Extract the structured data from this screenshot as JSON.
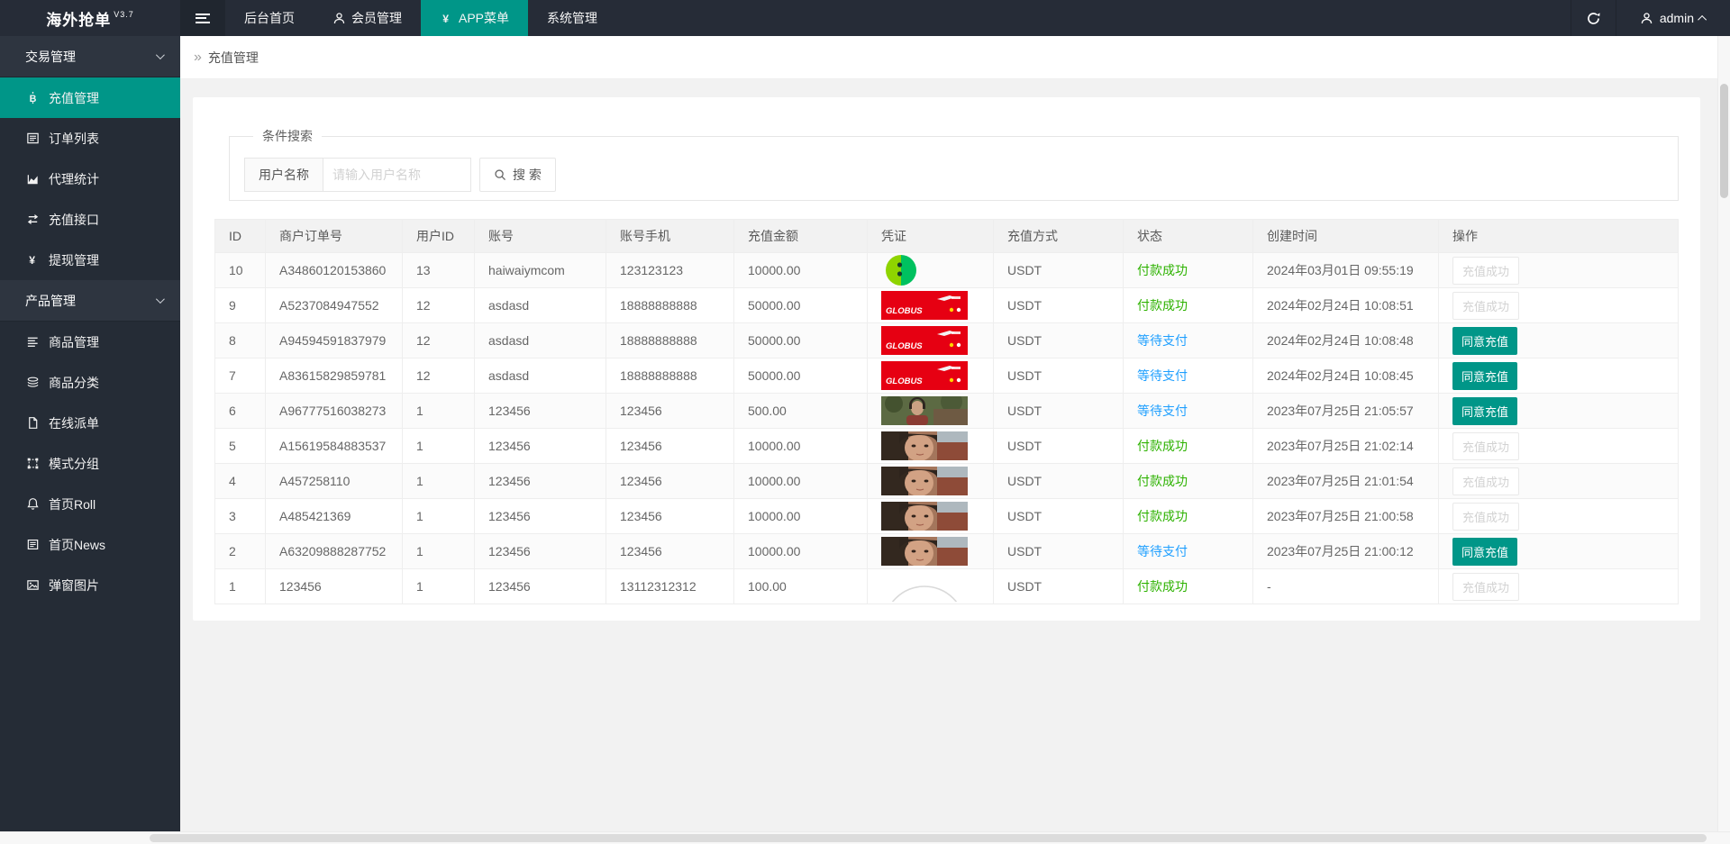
{
  "app": {
    "title": "海外抢单",
    "version": "V3.7",
    "admin": "admin"
  },
  "topnav": {
    "items": [
      {
        "key": "home",
        "label": "后台首页",
        "icon": null,
        "active": false
      },
      {
        "key": "members",
        "label": "会员管理",
        "icon": "person-icon",
        "active": false
      },
      {
        "key": "app-menu",
        "label": "APP菜单",
        "icon": "yen-icon",
        "active": true
      },
      {
        "key": "system",
        "label": "系统管理",
        "icon": null,
        "active": false
      }
    ]
  },
  "sidebar": {
    "items": [
      {
        "key": "trade-group",
        "type": "group",
        "label": "交易管理"
      },
      {
        "key": "recharge-manage",
        "type": "item",
        "label": "充值管理",
        "icon": "bitcoin-icon",
        "active": true
      },
      {
        "key": "order-list",
        "type": "item",
        "label": "订单列表",
        "icon": "order-frame-icon",
        "active": false
      },
      {
        "key": "agent-stats",
        "type": "item",
        "label": "代理统计",
        "icon": "area-chart-icon",
        "active": false
      },
      {
        "key": "recharge-api",
        "type": "item",
        "label": "充值接口",
        "icon": "swap-icon",
        "active": false
      },
      {
        "key": "withdraw-manage",
        "type": "item",
        "label": "提现管理",
        "icon": "yen-icon",
        "active": false
      },
      {
        "key": "product-group",
        "type": "group",
        "label": "产品管理"
      },
      {
        "key": "goods-manage",
        "type": "item",
        "label": "商品管理",
        "icon": "list-icon",
        "active": false
      },
      {
        "key": "goods-category",
        "type": "item",
        "label": "商品分类",
        "icon": "layers-icon",
        "active": false
      },
      {
        "key": "online-dispatch",
        "type": "item",
        "label": "在线派单",
        "icon": "file-icon",
        "active": false
      },
      {
        "key": "mode-group",
        "type": "item",
        "label": "模式分组",
        "icon": "object-group-icon",
        "active": false
      },
      {
        "key": "home-roll",
        "type": "item",
        "label": "首页Roll",
        "icon": "bell-icon",
        "active": false
      },
      {
        "key": "home-news",
        "type": "item",
        "label": "首页News",
        "icon": "news-icon",
        "active": false
      },
      {
        "key": "popup-image",
        "type": "item",
        "label": "弹窗图片",
        "icon": "image-icon",
        "active": false
      }
    ]
  },
  "breadcrumb": {
    "icon": "double-chevron-icon",
    "label": "充值管理",
    "icon_glyph": "»"
  },
  "search": {
    "legend": "条件搜索",
    "field_label": "用户名称",
    "placeholder": "请输入用户名称",
    "button": "搜 索"
  },
  "table": {
    "headers": [
      "ID",
      "商户订单号",
      "用户ID",
      "账号",
      "账号手机",
      "充值金额",
      "凭证",
      "充值方式",
      "状态",
      "创建时间",
      "操作"
    ],
    "rows": [
      {
        "id": "10",
        "order_no": "A34860120153860",
        "user_id": "13",
        "account": "haiwaiymcom",
        "phone": "123123123",
        "amount": "10000.00",
        "voucher": "green-logo-image",
        "method": "USDT",
        "status": "付款成功",
        "status_state": "success",
        "created": "2024年03月01日 09:55:19",
        "action": "充值成功",
        "action_state": "done"
      },
      {
        "id": "9",
        "order_no": "A5237084947552",
        "user_id": "12",
        "account": "asdasd",
        "phone": "18888888888",
        "amount": "50000.00",
        "voucher": "red-banner-image",
        "method": "USDT",
        "status": "付款成功",
        "status_state": "success",
        "created": "2024年02月24日 10:08:51",
        "action": "充值成功",
        "action_state": "done"
      },
      {
        "id": "8",
        "order_no": "A94594591837979",
        "user_id": "12",
        "account": "asdasd",
        "phone": "18888888888",
        "amount": "50000.00",
        "voucher": "red-banner-image",
        "method": "USDT",
        "status": "等待支付",
        "status_state": "waiting",
        "created": "2024年02月24日 10:08:48",
        "action": "同意充值",
        "action_state": "approve"
      },
      {
        "id": "7",
        "order_no": "A83615829859781",
        "user_id": "12",
        "account": "asdasd",
        "phone": "18888888888",
        "amount": "50000.00",
        "voucher": "red-banner-image",
        "method": "USDT",
        "status": "等待支付",
        "status_state": "waiting",
        "created": "2024年02月24日 10:08:45",
        "action": "同意充值",
        "action_state": "approve"
      },
      {
        "id": "6",
        "order_no": "A96777516038273",
        "user_id": "1",
        "account": "123456",
        "phone": "123456",
        "amount": "500.00",
        "voucher": "photo-outdoor-image",
        "method": "USDT",
        "status": "等待支付",
        "status_state": "waiting",
        "created": "2023年07月25日 21:05:57",
        "action": "同意充值",
        "action_state": "approve"
      },
      {
        "id": "5",
        "order_no": "A15619584883537",
        "user_id": "1",
        "account": "123456",
        "phone": "123456",
        "amount": "10000.00",
        "voucher": "photo-face-image",
        "method": "USDT",
        "status": "付款成功",
        "status_state": "success",
        "created": "2023年07月25日 21:02:14",
        "action": "充值成功",
        "action_state": "done"
      },
      {
        "id": "4",
        "order_no": "A457258110",
        "user_id": "1",
        "account": "123456",
        "phone": "123456",
        "amount": "10000.00",
        "voucher": "photo-face-image",
        "method": "USDT",
        "status": "付款成功",
        "status_state": "success",
        "created": "2023年07月25日 21:01:54",
        "action": "充值成功",
        "action_state": "done"
      },
      {
        "id": "3",
        "order_no": "A485421369",
        "user_id": "1",
        "account": "123456",
        "phone": "123456",
        "amount": "10000.00",
        "voucher": "photo-face-image",
        "method": "USDT",
        "status": "付款成功",
        "status_state": "success",
        "created": "2023年07月25日 21:00:58",
        "action": "充值成功",
        "action_state": "done"
      },
      {
        "id": "2",
        "order_no": "A63209888287752",
        "user_id": "1",
        "account": "123456",
        "phone": "123456",
        "amount": "10000.00",
        "voucher": "photo-face-image",
        "method": "USDT",
        "status": "等待支付",
        "status_state": "waiting",
        "created": "2023年07月25日 21:00:12",
        "action": "同意充值",
        "action_state": "approve"
      },
      {
        "id": "1",
        "order_no": "123456",
        "user_id": "1",
        "account": "123456",
        "phone": "13112312312",
        "amount": "100.00",
        "voucher": "grey-arc-image",
        "method": "USDT",
        "status": "付款成功",
        "status_state": "success",
        "created": "-",
        "action": "充值成功",
        "action_state": "done"
      }
    ]
  },
  "colors": {
    "accent": "#009688",
    "success_text": "#2db200",
    "waiting_text": "#1e9fff",
    "banner_red": "#e60012"
  }
}
